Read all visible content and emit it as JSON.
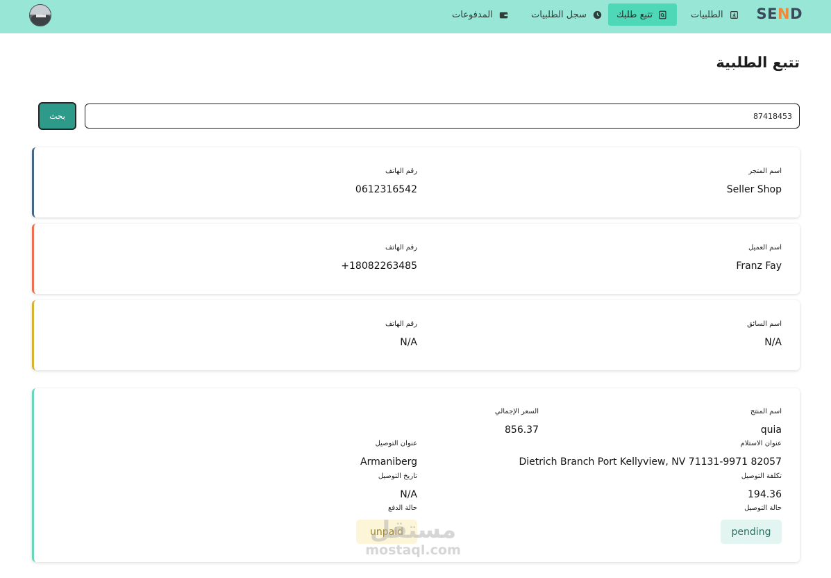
{
  "app": {
    "logo_text_start": "SE",
    "logo_text_n": "N",
    "logo_text_end": "D"
  },
  "nav": {
    "items": [
      {
        "label": "الطلبيات",
        "icon": "download-box-icon"
      },
      {
        "label": "تتبع طلبك",
        "icon": "search-doc-icon",
        "active": true
      },
      {
        "label": "سجل الطلبيات",
        "icon": "clock-icon"
      },
      {
        "label": "المدفوعات",
        "icon": "wallet-icon"
      }
    ]
  },
  "page": {
    "title": "تتبع الطلبية"
  },
  "search": {
    "value": "87418453",
    "button_label": "بحث"
  },
  "store": {
    "name_label": "اسم المتجر",
    "name_value": "Seller Shop",
    "phone_label": "رقم الهاتف",
    "phone_value": "0612316542"
  },
  "customer": {
    "name_label": "اسم العميل",
    "name_value": "Franz Fay",
    "phone_label": "رقم الهاتف",
    "phone_value": "+18082263485"
  },
  "driver": {
    "name_label": "اسم السائق",
    "name_value": "N/A",
    "phone_label": "رقم الهاتف",
    "phone_value": "N/A"
  },
  "order": {
    "product_label": "اسم المنتج",
    "product_value": "quia",
    "total_label": "السعر الإجمالي",
    "total_value": "856.37",
    "pickup_label": "عنوان الاستلام",
    "pickup_value": "Dietrich Branch Port Kellyview, NV 71131-9971 82057",
    "delivery_address_label": "عنوان التوصيل",
    "delivery_address_value": "Armaniberg",
    "delivery_cost_label": "تكلفة التوصيل",
    "delivery_cost_value": "194.36",
    "delivery_date_label": "تاريخ التوصيل",
    "delivery_date_value": "N/A",
    "delivery_status_label": "حالة التوصيل",
    "delivery_status_value": "pending",
    "payment_status_label": "حالة الدفع",
    "payment_status_value": "unpaid"
  },
  "watermark": {
    "arabic": "مستقل",
    "latin": "mostaql.com"
  },
  "colors": {
    "topbar": "#97e6d6",
    "nav_active": "#4ed8b7",
    "search_button": "#2e9a8a",
    "store_accent": "#456886",
    "customer_accent": "#ec6f52",
    "driver_accent": "#d5b334",
    "order_accent": "#68d6bb"
  }
}
